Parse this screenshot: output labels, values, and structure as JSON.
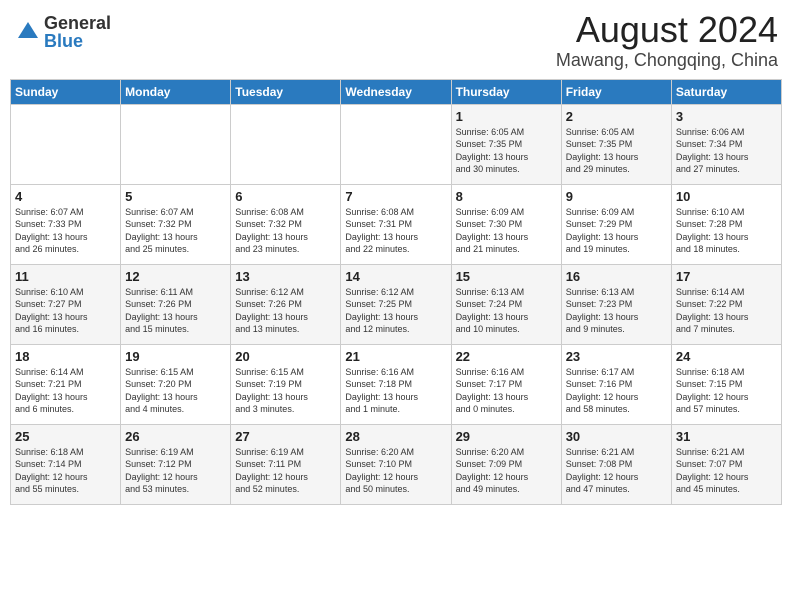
{
  "header": {
    "logo_general": "General",
    "logo_blue": "Blue",
    "month_year": "August 2024",
    "location": "Mawang, Chongqing, China"
  },
  "days_of_week": [
    "Sunday",
    "Monday",
    "Tuesday",
    "Wednesday",
    "Thursday",
    "Friday",
    "Saturday"
  ],
  "weeks": [
    [
      {
        "day": "",
        "info": ""
      },
      {
        "day": "",
        "info": ""
      },
      {
        "day": "",
        "info": ""
      },
      {
        "day": "",
        "info": ""
      },
      {
        "day": "1",
        "info": "Sunrise: 6:05 AM\nSunset: 7:35 PM\nDaylight: 13 hours\nand 30 minutes."
      },
      {
        "day": "2",
        "info": "Sunrise: 6:05 AM\nSunset: 7:35 PM\nDaylight: 13 hours\nand 29 minutes."
      },
      {
        "day": "3",
        "info": "Sunrise: 6:06 AM\nSunset: 7:34 PM\nDaylight: 13 hours\nand 27 minutes."
      }
    ],
    [
      {
        "day": "4",
        "info": "Sunrise: 6:07 AM\nSunset: 7:33 PM\nDaylight: 13 hours\nand 26 minutes."
      },
      {
        "day": "5",
        "info": "Sunrise: 6:07 AM\nSunset: 7:32 PM\nDaylight: 13 hours\nand 25 minutes."
      },
      {
        "day": "6",
        "info": "Sunrise: 6:08 AM\nSunset: 7:32 PM\nDaylight: 13 hours\nand 23 minutes."
      },
      {
        "day": "7",
        "info": "Sunrise: 6:08 AM\nSunset: 7:31 PM\nDaylight: 13 hours\nand 22 minutes."
      },
      {
        "day": "8",
        "info": "Sunrise: 6:09 AM\nSunset: 7:30 PM\nDaylight: 13 hours\nand 21 minutes."
      },
      {
        "day": "9",
        "info": "Sunrise: 6:09 AM\nSunset: 7:29 PM\nDaylight: 13 hours\nand 19 minutes."
      },
      {
        "day": "10",
        "info": "Sunrise: 6:10 AM\nSunset: 7:28 PM\nDaylight: 13 hours\nand 18 minutes."
      }
    ],
    [
      {
        "day": "11",
        "info": "Sunrise: 6:10 AM\nSunset: 7:27 PM\nDaylight: 13 hours\nand 16 minutes."
      },
      {
        "day": "12",
        "info": "Sunrise: 6:11 AM\nSunset: 7:26 PM\nDaylight: 13 hours\nand 15 minutes."
      },
      {
        "day": "13",
        "info": "Sunrise: 6:12 AM\nSunset: 7:26 PM\nDaylight: 13 hours\nand 13 minutes."
      },
      {
        "day": "14",
        "info": "Sunrise: 6:12 AM\nSunset: 7:25 PM\nDaylight: 13 hours\nand 12 minutes."
      },
      {
        "day": "15",
        "info": "Sunrise: 6:13 AM\nSunset: 7:24 PM\nDaylight: 13 hours\nand 10 minutes."
      },
      {
        "day": "16",
        "info": "Sunrise: 6:13 AM\nSunset: 7:23 PM\nDaylight: 13 hours\nand 9 minutes."
      },
      {
        "day": "17",
        "info": "Sunrise: 6:14 AM\nSunset: 7:22 PM\nDaylight: 13 hours\nand 7 minutes."
      }
    ],
    [
      {
        "day": "18",
        "info": "Sunrise: 6:14 AM\nSunset: 7:21 PM\nDaylight: 13 hours\nand 6 minutes."
      },
      {
        "day": "19",
        "info": "Sunrise: 6:15 AM\nSunset: 7:20 PM\nDaylight: 13 hours\nand 4 minutes."
      },
      {
        "day": "20",
        "info": "Sunrise: 6:15 AM\nSunset: 7:19 PM\nDaylight: 13 hours\nand 3 minutes."
      },
      {
        "day": "21",
        "info": "Sunrise: 6:16 AM\nSunset: 7:18 PM\nDaylight: 13 hours\nand 1 minute."
      },
      {
        "day": "22",
        "info": "Sunrise: 6:16 AM\nSunset: 7:17 PM\nDaylight: 13 hours\nand 0 minutes."
      },
      {
        "day": "23",
        "info": "Sunrise: 6:17 AM\nSunset: 7:16 PM\nDaylight: 12 hours\nand 58 minutes."
      },
      {
        "day": "24",
        "info": "Sunrise: 6:18 AM\nSunset: 7:15 PM\nDaylight: 12 hours\nand 57 minutes."
      }
    ],
    [
      {
        "day": "25",
        "info": "Sunrise: 6:18 AM\nSunset: 7:14 PM\nDaylight: 12 hours\nand 55 minutes."
      },
      {
        "day": "26",
        "info": "Sunrise: 6:19 AM\nSunset: 7:12 PM\nDaylight: 12 hours\nand 53 minutes."
      },
      {
        "day": "27",
        "info": "Sunrise: 6:19 AM\nSunset: 7:11 PM\nDaylight: 12 hours\nand 52 minutes."
      },
      {
        "day": "28",
        "info": "Sunrise: 6:20 AM\nSunset: 7:10 PM\nDaylight: 12 hours\nand 50 minutes."
      },
      {
        "day": "29",
        "info": "Sunrise: 6:20 AM\nSunset: 7:09 PM\nDaylight: 12 hours\nand 49 minutes."
      },
      {
        "day": "30",
        "info": "Sunrise: 6:21 AM\nSunset: 7:08 PM\nDaylight: 12 hours\nand 47 minutes."
      },
      {
        "day": "31",
        "info": "Sunrise: 6:21 AM\nSunset: 7:07 PM\nDaylight: 12 hours\nand 45 minutes."
      }
    ]
  ]
}
